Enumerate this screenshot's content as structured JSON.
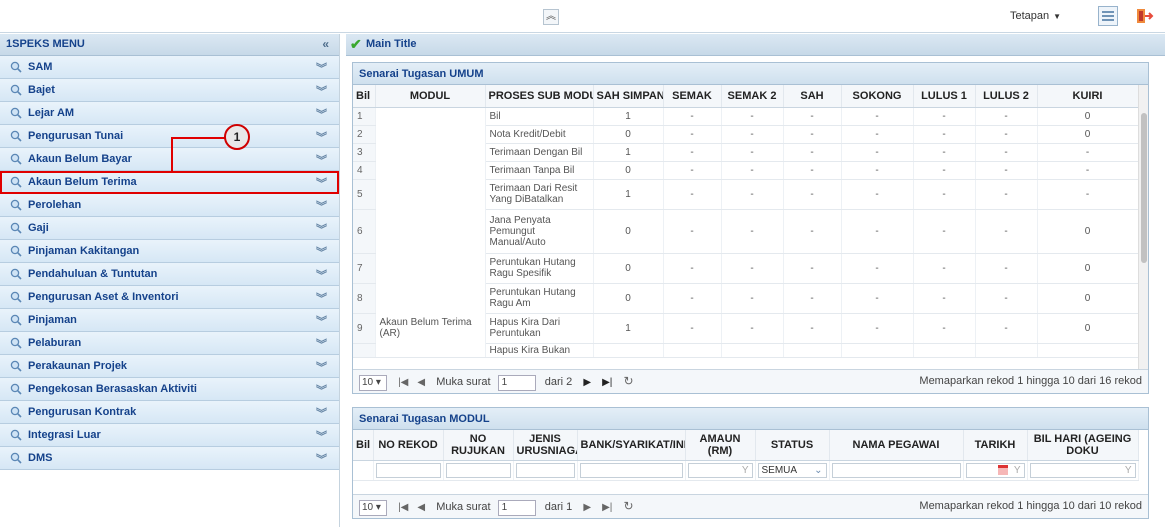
{
  "topbar": {
    "tetapan": "Tetapan",
    "caret": "▼",
    "collapse": "≈"
  },
  "menu": {
    "title": "1SPEKS MENU",
    "items": [
      {
        "label": "SAM"
      },
      {
        "label": "Bajet"
      },
      {
        "label": "Lejar AM"
      },
      {
        "label": "Pengurusan Tunai"
      },
      {
        "label": "Akaun Belum Bayar"
      },
      {
        "label": "Akaun Belum Terima"
      },
      {
        "label": "Perolehan"
      },
      {
        "label": "Gaji"
      },
      {
        "label": "Pinjaman Kakitangan"
      },
      {
        "label": "Pendahuluan & Tuntutan"
      },
      {
        "label": "Pengurusan Aset & Inventori"
      },
      {
        "label": "Pinjaman"
      },
      {
        "label": "Pelaburan"
      },
      {
        "label": "Perakaunan Projek"
      },
      {
        "label": "Pengekosan Berasaskan Aktiviti"
      },
      {
        "label": "Pengurusan Kontrak"
      },
      {
        "label": "Integrasi Luar"
      },
      {
        "label": "DMS"
      }
    ],
    "highlighted_index": 5
  },
  "callout": {
    "number": "1"
  },
  "main": {
    "title": "Main Title"
  },
  "umum": {
    "title": "Senarai Tugasan UMUM",
    "columns": [
      "Bil",
      "MODUL",
      "PROSES SUB MODU",
      "SAH SIMPAN",
      "SEMAK",
      "SEMAK 2",
      "SAH",
      "SOKONG",
      "LULUS 1",
      "LULUS 2",
      "KUIRI"
    ],
    "modul": "Akaun Belum Terima (AR)",
    "rows": [
      {
        "bil": "1",
        "proses": "Bil",
        "vals": [
          "1",
          "-",
          "-",
          "-",
          "-",
          "-",
          "-",
          "0"
        ]
      },
      {
        "bil": "2",
        "proses": "Nota Kredit/Debit",
        "vals": [
          "0",
          "-",
          "-",
          "-",
          "-",
          "-",
          "-",
          "0"
        ]
      },
      {
        "bil": "3",
        "proses": "Terimaan Dengan Bil",
        "vals": [
          "1",
          "-",
          "-",
          "-",
          "-",
          "-",
          "-",
          "-"
        ]
      },
      {
        "bil": "4",
        "proses": "Terimaan Tanpa Bil",
        "vals": [
          "0",
          "-",
          "-",
          "-",
          "-",
          "-",
          "-",
          "-"
        ]
      },
      {
        "bil": "5",
        "proses": "Terimaan Dari Resit Yang DiBatalkan",
        "vals": [
          "1",
          "-",
          "-",
          "-",
          "-",
          "-",
          "-",
          "-"
        ]
      },
      {
        "bil": "6",
        "proses": "Jana Penyata Pemungut Manual/Auto",
        "vals": [
          "0",
          "-",
          "-",
          "-",
          "-",
          "-",
          "-",
          "0"
        ]
      },
      {
        "bil": "7",
        "proses": "Peruntukan Hutang Ragu Spesifik",
        "vals": [
          "0",
          "-",
          "-",
          "-",
          "-",
          "-",
          "-",
          "0"
        ]
      },
      {
        "bil": "8",
        "proses": "Peruntukan Hutang Ragu Am",
        "vals": [
          "0",
          "-",
          "-",
          "-",
          "-",
          "-",
          "-",
          "0"
        ]
      },
      {
        "bil": "9",
        "proses": "Hapus Kira Dari Peruntukan",
        "vals": [
          "1",
          "-",
          "-",
          "-",
          "-",
          "-",
          "-",
          "0"
        ]
      },
      {
        "bil": "",
        "proses": "Hapus Kira Bukan",
        "vals": [
          "",
          "",
          "",
          "",
          "",
          "",
          "",
          ""
        ]
      }
    ],
    "pager": {
      "size": "10 ▾",
      "page_label": "Muka surat",
      "page": "1",
      "of": "dari 2",
      "info": "Memaparkan rekod 1 hingga 10 dari 16 rekod"
    }
  },
  "modul": {
    "title": "Senarai Tugasan MODUL",
    "columns": [
      "Bil",
      "NO REKOD",
      "NO RUJUKAN",
      "JENIS URUSNIAGA",
      "BANK/SYARIKAT/IND",
      "AMAUN (RM)",
      "STATUS",
      "NAMA PEGAWAI",
      "TARIKH",
      "BIL HARI (AGEING DOKU"
    ],
    "status_filter": "SEMUA",
    "pager": {
      "size": "10 ▾",
      "page_label": "Muka surat",
      "page": "1",
      "of": "dari 1",
      "info": "Memaparkan rekod 1 hingga 10 dari 10 rekod"
    }
  }
}
